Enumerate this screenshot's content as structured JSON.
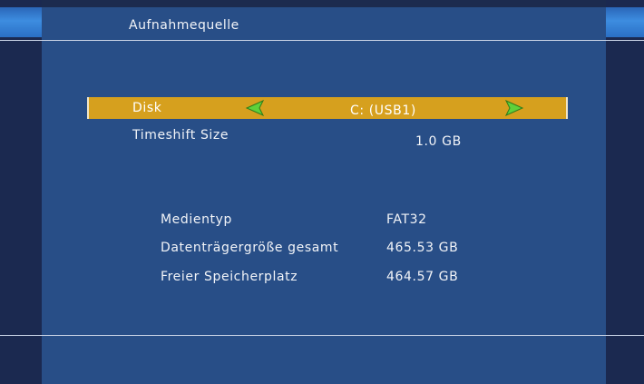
{
  "header": {
    "title": "Aufnahmequelle"
  },
  "settings": {
    "disk": {
      "label": "Disk",
      "value": "C: (USB1)"
    },
    "timeshift": {
      "label": "Timeshift Size",
      "value": "1.0 GB"
    }
  },
  "info": {
    "media_type": {
      "label": "Medientyp",
      "value": "FAT32"
    },
    "total_size": {
      "label": "Datenträgergröße gesamt",
      "value": "465.53 GB"
    },
    "free_space": {
      "label": "Freier Speicherplatz",
      "value": "464.57 GB"
    }
  },
  "colors": {
    "panel": "#284e87",
    "frame": "#1b2950",
    "highlight": "#d6a01e",
    "arrow": "#5fd13a"
  },
  "icons": {
    "prev": "arrow-left-icon",
    "next": "arrow-right-icon"
  }
}
